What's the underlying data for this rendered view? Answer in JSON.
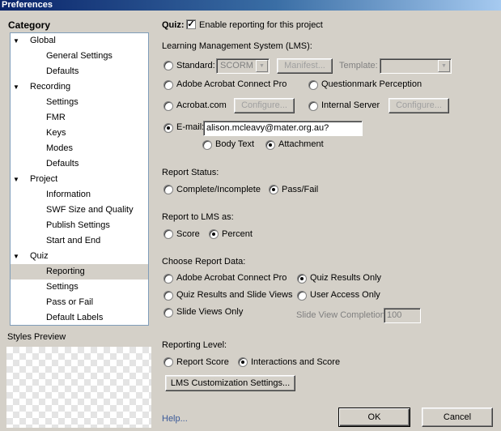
{
  "window": {
    "title": "Preferences"
  },
  "category": {
    "heading": "Category",
    "items": [
      {
        "label": "Global",
        "level": 0,
        "expanded": true
      },
      {
        "label": "General Settings",
        "level": 1
      },
      {
        "label": "Defaults",
        "level": 1
      },
      {
        "label": "Recording",
        "level": 0,
        "expanded": true
      },
      {
        "label": "Settings",
        "level": 1
      },
      {
        "label": "FMR",
        "level": 1
      },
      {
        "label": "Keys",
        "level": 1
      },
      {
        "label": "Modes",
        "level": 1
      },
      {
        "label": "Defaults",
        "level": 1
      },
      {
        "label": "Project",
        "level": 0,
        "expanded": true
      },
      {
        "label": "Information",
        "level": 1
      },
      {
        "label": "SWF Size and Quality",
        "level": 1
      },
      {
        "label": "Publish Settings",
        "level": 1
      },
      {
        "label": "Start and End",
        "level": 1
      },
      {
        "label": "Quiz",
        "level": 0,
        "expanded": true
      },
      {
        "label": "Reporting",
        "level": 1,
        "selected": true
      },
      {
        "label": "Settings",
        "level": 1
      },
      {
        "label": "Pass or Fail",
        "level": 1
      },
      {
        "label": "Default Labels",
        "level": 1
      }
    ],
    "expand_glyph": "▼",
    "styles_preview_label": "Styles Preview"
  },
  "quiz": {
    "label": "Quiz:",
    "enable_reporting_label": "Enable reporting for this project",
    "enable_reporting_checked": true
  },
  "lms": {
    "heading": "Learning Management System (LMS):",
    "standard_label": "Standard:",
    "standard_value": "SCORM",
    "manifest_label": "Manifest...",
    "template_label": "Template:",
    "template_value": "",
    "adobe_connect_label": "Adobe Acrobat Connect Pro",
    "questionmark_label": "Questionmark Perception",
    "acrobat_com_label": "Acrobat.com",
    "configure_label": "Configure...",
    "internal_server_label": "Internal Server",
    "configure2_label": "Configure...",
    "email_label": "E-mail:",
    "email_value": "alison.mcleavy@mater.org.au?subject=",
    "body_text_label": "Body Text",
    "attachment_label": "Attachment",
    "selected": "E-mail:",
    "email_format_selected": "Attachment"
  },
  "report_status": {
    "heading": "Report Status:",
    "complete_label": "Complete/Incomplete",
    "passfail_label": "Pass/Fail",
    "selected": "Pass/Fail"
  },
  "report_to_lms": {
    "heading": "Report to LMS as:",
    "score_label": "Score",
    "percent_label": "Percent",
    "selected": "Percent"
  },
  "report_data": {
    "heading": "Choose Report Data:",
    "adobe_connect_label": "Adobe Acrobat Connect Pro",
    "quiz_results_only_label": "Quiz Results Only",
    "quiz_and_slide_label": "Quiz Results and Slide Views",
    "user_access_label": "User Access Only",
    "slide_views_label": "Slide Views Only",
    "slide_view_completion_label": "Slide View Completion",
    "slide_view_completion_value": "100",
    "selected": "Quiz Results Only"
  },
  "reporting_level": {
    "heading": "Reporting Level:",
    "report_score_label": "Report Score",
    "interactions_label": "Interactions and Score",
    "selected": "Interactions and Score"
  },
  "buttons": {
    "lms_custom_label": "LMS Customization Settings...",
    "help_label": "Help...",
    "ok_label": "OK",
    "cancel_label": "Cancel"
  },
  "colors": {
    "dialog_bg": "#d4d0c8",
    "title_start": "#0a246a",
    "tree_border": "#7f9db9",
    "link": "#3b5a99"
  }
}
